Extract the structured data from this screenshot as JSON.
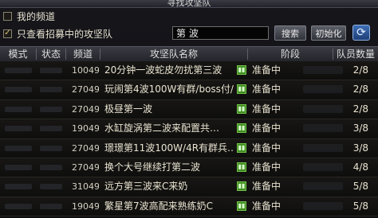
{
  "window": {
    "title": "寻找攻坚队"
  },
  "options": [
    {
      "label": "我的频道",
      "checked": false
    },
    {
      "label": "只查看招募中的攻坚队",
      "checked": true
    }
  ],
  "search": {
    "value": "第 波",
    "button": "搜索",
    "reset": "初始化",
    "refresh_icon": "refresh-icon"
  },
  "columns": [
    "模式",
    "状态",
    "频道",
    "攻坚队名称",
    "阶段",
    "队员数量"
  ],
  "rows": [
    {
      "channel": "10049",
      "name": "20分钟一波蛇皮勿扰第三波",
      "stage": "准备中",
      "members": "2/8"
    },
    {
      "channel": "27049",
      "name": "玩闹第4波100W有群/boss付/",
      "stage": "准备中",
      "members": "2/8"
    },
    {
      "channel": "27049",
      "name": "极昼第一波",
      "stage": "准备中",
      "members": "2/8"
    },
    {
      "channel": "19049",
      "name": "水缸旋涡第二波来配置共…",
      "stage": "准备中",
      "members": "3/8"
    },
    {
      "channel": "27049",
      "name": "璟璟第11波100W/4R有群兵…",
      "stage": "准备中",
      "members": "3/8"
    },
    {
      "channel": "27049",
      "name": "换个大号继续打第二波",
      "stage": "准备中",
      "members": "4/8"
    },
    {
      "channel": "31049",
      "name": "远方第三波来C来奶",
      "stage": "准备中",
      "members": "5/8"
    },
    {
      "channel": "19049",
      "name": "繁星第7波高配来熟练奶C",
      "stage": "准备中",
      "members": "5/8"
    }
  ]
}
